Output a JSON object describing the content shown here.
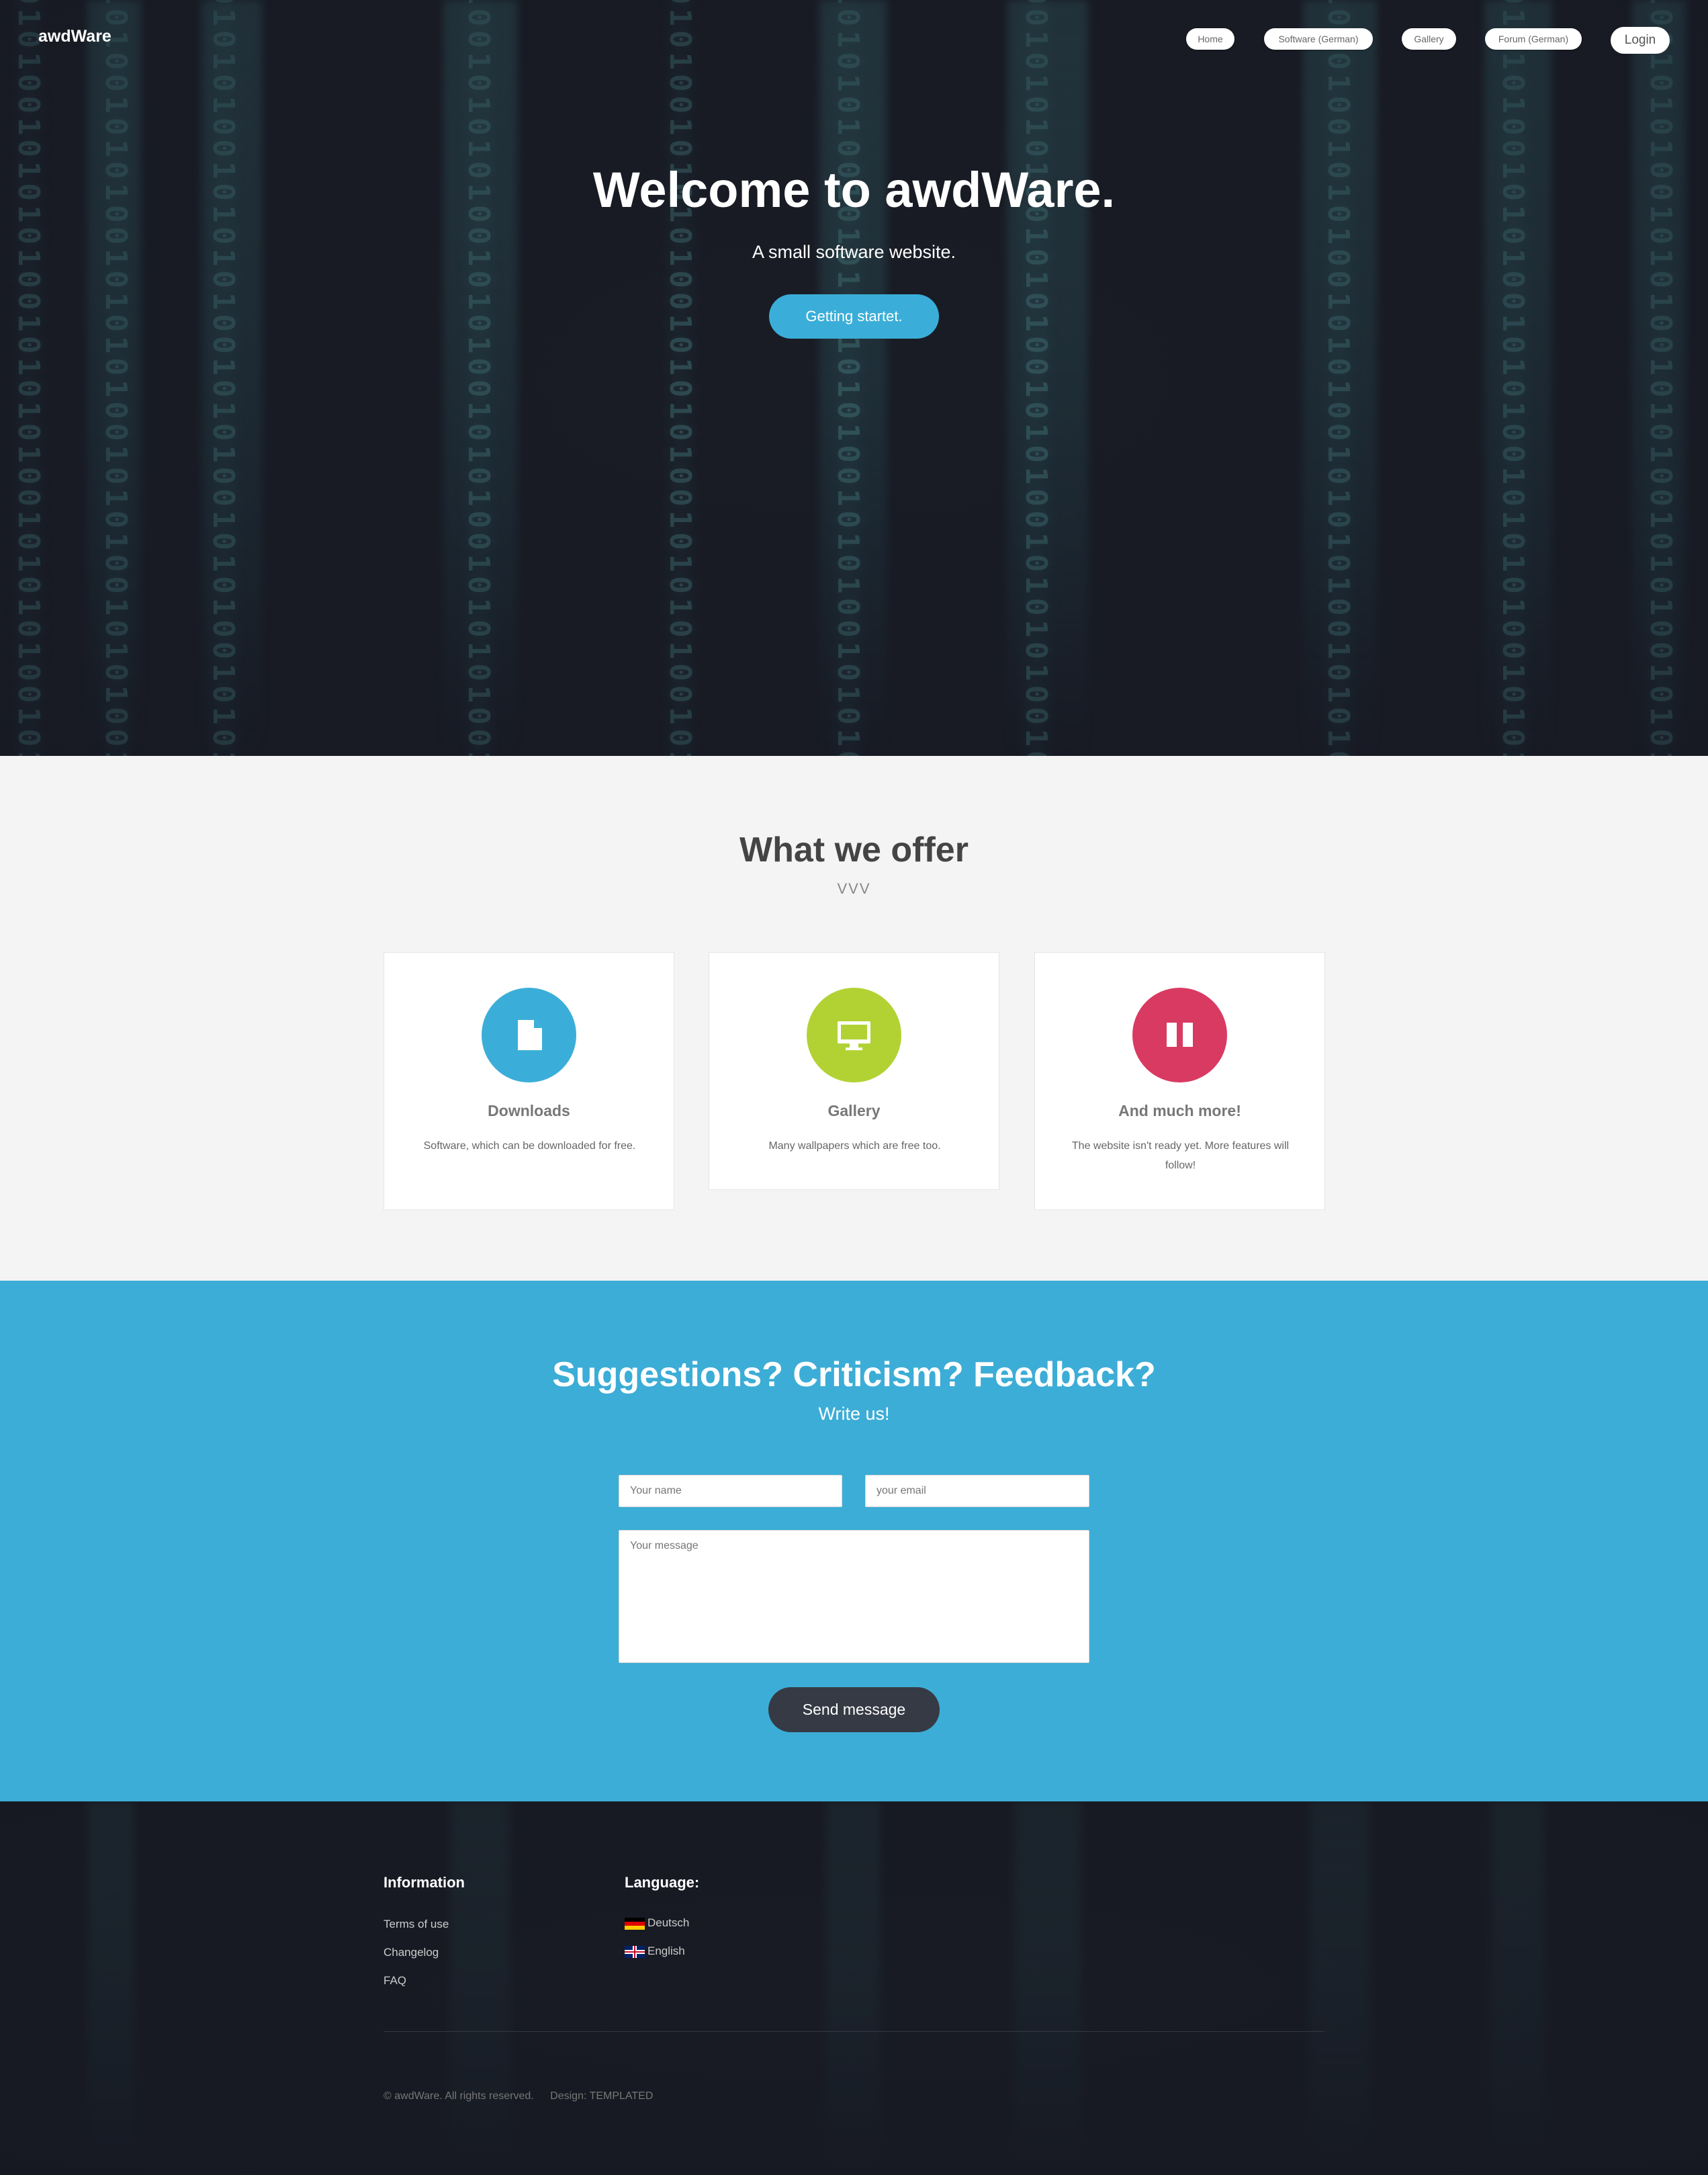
{
  "brand": "awdWare",
  "nav": {
    "items": [
      {
        "label": "Home"
      },
      {
        "label": "Software (German)"
      },
      {
        "label": "Gallery"
      },
      {
        "label": "Forum (German)"
      }
    ],
    "login": "Login"
  },
  "hero": {
    "title": "Welcome to awdWare.",
    "subtitle": "A small software website.",
    "button": "Getting startet."
  },
  "offer": {
    "title": "What we offer",
    "subtitle": "VVV",
    "cards": [
      {
        "title": "Downloads",
        "text": "Software, which can be downloaded for free.",
        "icon": "file-icon",
        "color": "#3aaed8"
      },
      {
        "title": "Gallery",
        "text": "Many wallpapers which are free too.",
        "icon": "desktop-icon",
        "color": "#b2d234"
      },
      {
        "title": "And much more!",
        "text": "The website isn't ready yet. More features will follow!",
        "icon": "columns-icon",
        "color": "#d93a62"
      }
    ]
  },
  "contact": {
    "title": "Suggestions? Criticism? Feedback?",
    "subtitle": "Write us!",
    "name_placeholder": "Your name",
    "email_placeholder": "your email",
    "message_placeholder": "Your message",
    "send": "Send message"
  },
  "footer": {
    "info_heading": "Information",
    "info_links": [
      "Terms of use",
      "Changelog",
      "FAQ"
    ],
    "language_heading": "Language:",
    "languages": [
      "Deutsch",
      "English"
    ],
    "copyright": "© awdWare. All rights reserved.",
    "design": "Design: TEMPLATED"
  },
  "colors": {
    "accent": "#3cadd6",
    "green": "#b2d234",
    "red": "#d93a62",
    "dark": "#1a1d25"
  }
}
